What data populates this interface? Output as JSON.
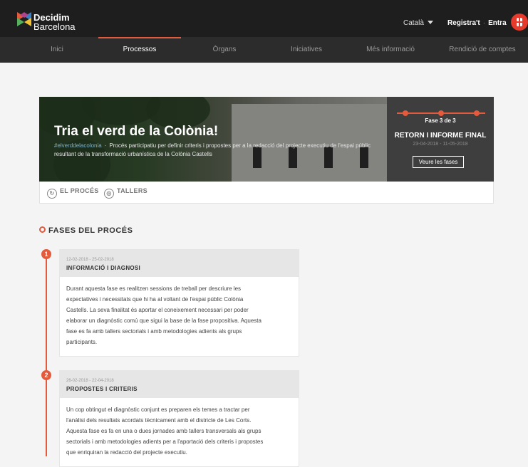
{
  "header": {
    "brand_line1": "Decidim",
    "brand_line2": "Barcelona",
    "language": "Català",
    "register": "Registra't",
    "separator": "·",
    "login": "Entra"
  },
  "nav": {
    "items": [
      "Inici",
      "Processos",
      "Òrgans",
      "Iniciatives",
      "Més informació",
      "Rendició de comptes"
    ],
    "active_index": 1
  },
  "hero": {
    "title": "Tria el verd de la Colònia!",
    "hashtag": "#elverddelacolonia",
    "dot": "·",
    "description": "Procés participatiu per definir criteris i propostes per a la redacció del projecte executiu de l'espai públic resultant de la transformació urbanística de la Colònia Castells",
    "phase_count": "Fase 3 de 3",
    "phase_name": "RETORN I INFORME FINAL",
    "phase_dates": "23-04-2018 - 11-05-2018",
    "phases_button": "Veure les fases"
  },
  "tabs": [
    {
      "label": "EL PROCÉS",
      "icon": "process-icon"
    },
    {
      "label": "TALLERS",
      "icon": "workshop-icon"
    }
  ],
  "section": {
    "title": "FASES DEL PROCÉS"
  },
  "phases": [
    {
      "number": "1",
      "dates": "12-02-2018 - 25-02-2018",
      "title": "INFORMACIÓ I DIAGNOSI",
      "lines": [
        "Durant aquesta fase es realitzen sessions de treball per descriure les",
        "expectatives i necessitats que hi ha al voltant de l'espai públic Colònia",
        "Castells. La seva finalitat és aportar el coneixement necessari per poder",
        "elaborar un diagnòstic comú que sigui la base de la fase propositiva. Aquesta",
        "fase es fa amb tallers sectorials i amb metodologies adients als grups",
        "participants."
      ]
    },
    {
      "number": "2",
      "dates": "26-02-2018 - 22-04-2018",
      "title": "PROPOSTES I CRITERIS",
      "lines": [
        "Un cop obtingut el diagnòstic conjunt es preparen els temes a tractar per",
        "l'anàlisi dels resultats acordats tècnicament amb el districte de Les Corts.",
        "Aquesta fase es fa en una o dues jornades amb tallers transversals als grups",
        "sectorials i amb metodologies adients per a l'aportació dels criteris i propostes",
        "que enriquiran la redacció del projecte executiu."
      ]
    }
  ],
  "colors": {
    "accent": "#e35a3c",
    "topbar": "#1e1e1e",
    "navbar": "#2c2c2c",
    "badge": "#e53a2c"
  }
}
